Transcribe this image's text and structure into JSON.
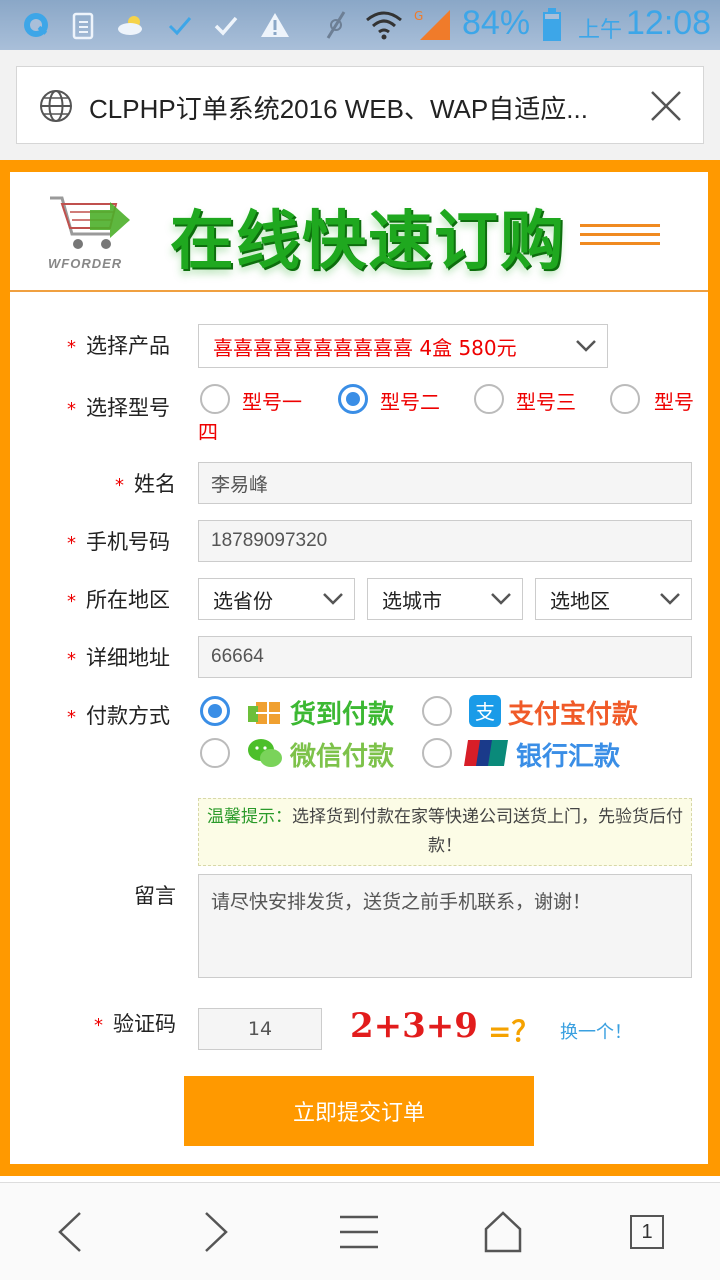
{
  "statusbar": {
    "battery_pct": "84%",
    "ampm": "上午",
    "time": "12:08",
    "icons": [
      "q-app-icon",
      "clipboard-icon",
      "weather-icon",
      "check-icon",
      "check-icon",
      "warning-icon",
      "mute-icon",
      "wifi-icon",
      "signal-icon",
      "battery-icon"
    ]
  },
  "browser": {
    "title": "CLPHP订单系统2016 WEB、WAP自适应...",
    "progress": 0.98
  },
  "banner": {
    "logo_text": "WFORDER",
    "title": "在线快速订购"
  },
  "form": {
    "product": {
      "label": "选择产品",
      "value": "喜喜喜喜喜喜喜喜喜喜 4盒 580元"
    },
    "model": {
      "label": "选择型号",
      "options": [
        "型号一",
        "型号二",
        "型号三",
        "型号"
      ],
      "wrap": "四",
      "selected_index": 1
    },
    "name": {
      "label": "姓名",
      "value": "李易峰"
    },
    "phone": {
      "label": "手机号码",
      "value": "18789097320"
    },
    "region": {
      "label": "所在地区",
      "province": "选省份",
      "city": "选城市",
      "district": "选地区"
    },
    "address": {
      "label": "详细地址",
      "value": "66664"
    },
    "payment": {
      "label": "付款方式",
      "options": [
        "货到付款",
        "支付宝付款",
        "微信付款",
        "银行汇款"
      ],
      "selected_index": 0
    },
    "tip": {
      "title": "温馨提示：",
      "text": "选择货到付款在家等快递公司送货上门，先验货后付款！"
    },
    "message": {
      "label": "留言",
      "placeholder": "请尽快安排发货，送货之前手机联系，谢谢！"
    },
    "captcha": {
      "label": "验证码",
      "value": "14",
      "expression": "2+3+9",
      "eq": "=？",
      "refresh": "换一个！"
    },
    "submit": "立即提交订单"
  },
  "navbar": {
    "tab_count": "1"
  },
  "colors": {
    "accent": "#ff9900",
    "link": "#3a8ee6",
    "required": "#ee0000",
    "banner_green": "#1fa81f"
  }
}
